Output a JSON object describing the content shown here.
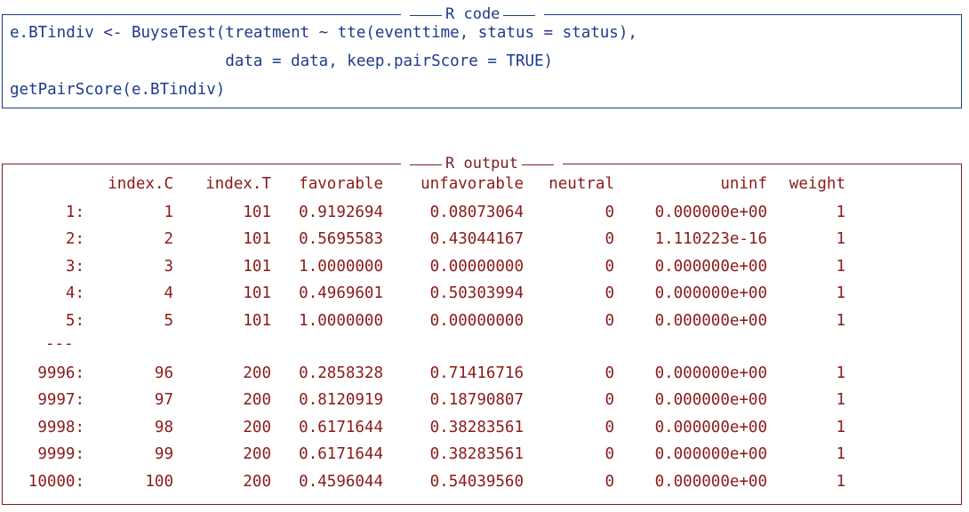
{
  "code_box": {
    "title": "R code",
    "lines": [
      "e.BTindiv <- BuyseTest(treatment ~ tte(eventtime, status = status),",
      "                       data = data, keep.pairScore = TRUE)",
      "getPairScore(e.BTindiv)"
    ]
  },
  "output_box": {
    "title": "R output",
    "headers": [
      "index.C",
      "index.T",
      "favorable",
      "unfavorable",
      "neutral",
      "uninf",
      "weight"
    ],
    "rows_top": [
      {
        "id": "1:",
        "index_c": "1",
        "index_t": "101",
        "favorable": "0.9192694",
        "unfavorable": "0.08073064",
        "neutral": "0",
        "uninf": "0.000000e+00",
        "weight": "1"
      },
      {
        "id": "2:",
        "index_c": "2",
        "index_t": "101",
        "favorable": "0.5695583",
        "unfavorable": "0.43044167",
        "neutral": "0",
        "uninf": "1.110223e-16",
        "weight": "1"
      },
      {
        "id": "3:",
        "index_c": "3",
        "index_t": "101",
        "favorable": "1.0000000",
        "unfavorable": "0.00000000",
        "neutral": "0",
        "uninf": "0.000000e+00",
        "weight": "1"
      },
      {
        "id": "4:",
        "index_c": "4",
        "index_t": "101",
        "favorable": "0.4969601",
        "unfavorable": "0.50303994",
        "neutral": "0",
        "uninf": "0.000000e+00",
        "weight": "1"
      },
      {
        "id": "5:",
        "index_c": "5",
        "index_t": "101",
        "favorable": "1.0000000",
        "unfavorable": "0.00000000",
        "neutral": "0",
        "uninf": "0.000000e+00",
        "weight": "1"
      }
    ],
    "separator": "---",
    "rows_bottom": [
      {
        "id": "9996:",
        "index_c": "96",
        "index_t": "200",
        "favorable": "0.2858328",
        "unfavorable": "0.71416716",
        "neutral": "0",
        "uninf": "0.000000e+00",
        "weight": "1"
      },
      {
        "id": "9997:",
        "index_c": "97",
        "index_t": "200",
        "favorable": "0.8120919",
        "unfavorable": "0.18790807",
        "neutral": "0",
        "uninf": "0.000000e+00",
        "weight": "1"
      },
      {
        "id": "9998:",
        "index_c": "98",
        "index_t": "200",
        "favorable": "0.6171644",
        "unfavorable": "0.38283561",
        "neutral": "0",
        "uninf": "0.000000e+00",
        "weight": "1"
      },
      {
        "id": "9999:",
        "index_c": "99",
        "index_t": "200",
        "favorable": "0.6171644",
        "unfavorable": "0.38283561",
        "neutral": "0",
        "uninf": "0.000000e+00",
        "weight": "1"
      },
      {
        "id": "10000:",
        "index_c": "100",
        "index_t": "200",
        "favorable": "0.4596044",
        "unfavorable": "0.54039560",
        "neutral": "0",
        "uninf": "0.000000e+00",
        "weight": "1"
      }
    ]
  }
}
